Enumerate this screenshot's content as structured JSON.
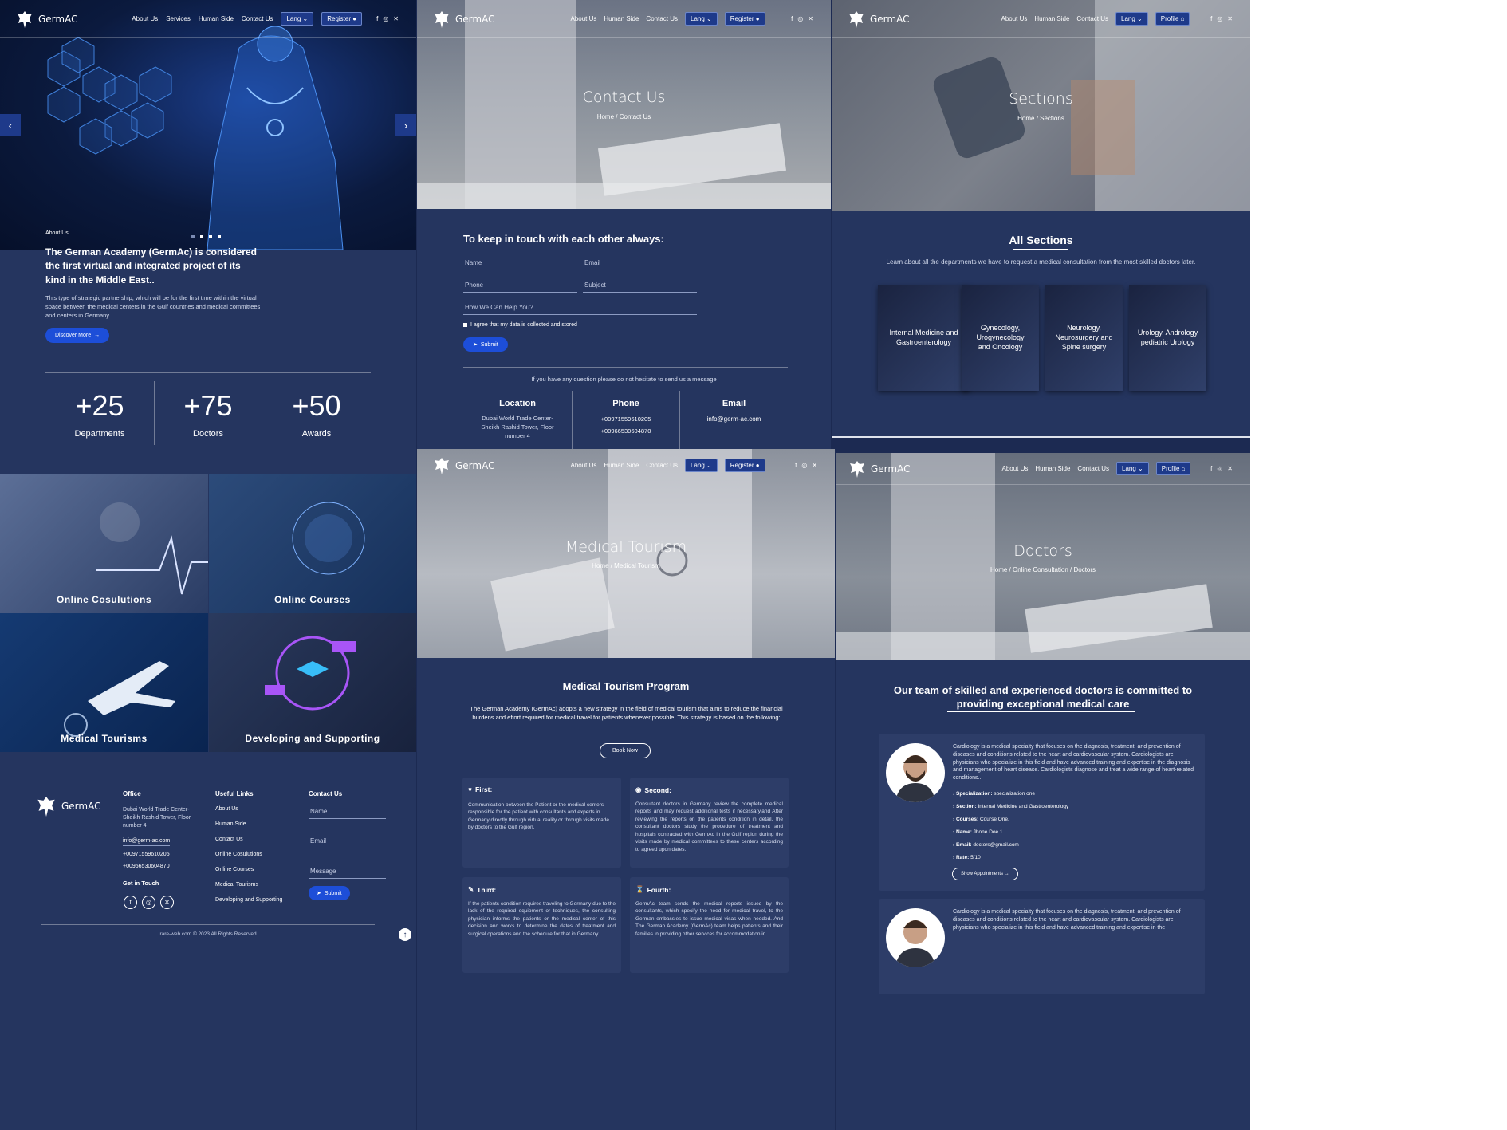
{
  "brand": "GermAC",
  "nav": {
    "about": "About Us",
    "services": "Services",
    "human": "Human Side",
    "contact": "Contact Us",
    "lang": "Lang",
    "register": "Register",
    "profile": "Profile"
  },
  "home": {
    "about_label": "About Us",
    "about_title": "The German Academy (GermAc) is considered the first virtual and integrated project of its kind in the Middle East..",
    "about_text": "This type of strategic partnership, which will be for the first time within the virtual space between the medical centers in the Gulf countries and medical committees and centers in Germany.",
    "discover": "Discover More",
    "stats": [
      {
        "value": "+25",
        "label": "Departments"
      },
      {
        "value": "+75",
        "label": "Doctors"
      },
      {
        "value": "+50",
        "label": "Awards"
      }
    ],
    "tiles": [
      "Online Cosulutions",
      "Online Courses",
      "Medical Tourisms",
      "Developing and Supporting"
    ]
  },
  "footer": {
    "office_h": "Office",
    "office_addr": "Dubai World Trade Center- Sheikh Rashid Tower, Floor number 4",
    "email": "info@germ-ac.com",
    "phone1": "+00971559610205",
    "phone2": "+00966530604870",
    "touch": "Get in Touch",
    "links_h": "Useful Links",
    "links": [
      "About Us",
      "Human Side",
      "Contact Us",
      "Online Cosulutions",
      "Online Courses",
      "Medical Tourisms",
      "Developing and Supporting"
    ],
    "contact_h": "Contact Us",
    "name": "Name",
    "emailf": "Email",
    "message": "Message",
    "submit": "Submit",
    "copyright": "rare-web.com © 2023 All Rights Reserved"
  },
  "contact": {
    "title": "Contact Us",
    "crumb": "Home / Contact Us",
    "heading": "To keep in touch with each other always:",
    "name": "Name",
    "email": "Email",
    "phone": "Phone",
    "subject": "Subject",
    "help": "How We Can Help You?",
    "agree": "I agree that my data is collected and stored",
    "submit": "Submit",
    "note": "If you have any question please do not hesitate to send us a message",
    "loc_h": "Location",
    "loc": "Dubai World Trade Center- Sheikh Rashid Tower, Floor number 4",
    "phone_h": "Phone",
    "ph1": "+00971559610205",
    "ph2": "+00966530604870",
    "email_h": "Email",
    "em": "info@germ-ac.com"
  },
  "sections": {
    "title": "Sections",
    "crumb": "Home / Sections",
    "heading": "All Sections",
    "sub": "Learn about all the departments we have to request a medical consultation from the most skilled doctors later.",
    "cards": [
      "Internal Medicine and Gastroenterology",
      "Gynecology, Urogynecology and Oncology",
      "Neurology, Neurosurgery and Spine surgery",
      "Urology, Andrology pediatric Urology"
    ]
  },
  "tourism": {
    "title": "Medical Tourism",
    "crumb": "Home / Medical Tourism",
    "heading": "Medical Tourism Program",
    "intro": "The German Academy (GermAc) adopts a new strategy in the field of medical tourism that aims to reduce the financial burdens and effort required for medical travel for patients whenever possible. This strategy is based on the following:",
    "book": "Book Now",
    "steps": [
      {
        "h": "First:",
        "t": "Communication between the Patient or the medical centers responsible for the patient with consultants and experts in Germany directly through virtual reality or through visits made by doctors to the Gulf region."
      },
      {
        "h": "Second:",
        "t": "Consultant doctors in Germany review the complete medical reports and may request additional tests if necessary,and After reviewing the reports on the patients condition in detail, the consultant doctors study the procedure of treatment and hospitals contracted with GermAc in the Gulf region during the visits made by medical committees to these centers according to agreed upon dates."
      },
      {
        "h": "Third:",
        "t": "If the patients condition requires traveling to Germany due to the lack of the required equipment or techniques, the consulting physician informs the patients or the medical center of this decision and works to determine the dates of treatment and surgical operations and the schedule for that in Germany."
      },
      {
        "h": "Fourth:",
        "t": "GermAc team sends the medical reports issued by the consultants, which specify the need for medical travel, to the German embassies to issue medical visas when needed. And The German Academy (GermAc) team helps patients and their families in providing other services for accommodation in"
      }
    ]
  },
  "doctors": {
    "title": "Doctors",
    "crumb": "Home / Online Consultation / Doctors",
    "heading": "Our team of skilled and experienced doctors is committed to providing exceptional medical care",
    "desc": "Cardiology is a medical specialty that focuses on the diagnosis, treatment, and prevention of diseases and conditions related to the heart and cardiovascular system. Cardiologists are physicians who specialize in this field and have advanced training and expertise in the diagnosis and management of heart disease. Cardiologists diagnose and treat a wide range of heart-related conditions..",
    "desc2": "Cardiology is a medical specialty that focuses on the diagnosis, treatment, and prevention of diseases and conditions related to the heart and cardiovascular system. Cardiologists are physicians who specialize in this field and have advanced training and expertise in the",
    "spec_l": "Specialization:",
    "spec": "specialization one",
    "sec_l": "Section:",
    "sec": "Internal Medicine and Gastroenterology",
    "course_l": "Courses:",
    "course": "Course One,",
    "name_l": "Name:",
    "name": "Jhone Doe 1",
    "email_l": "Email:",
    "email": "doctors@gmail.com",
    "rate_l": "Rate:",
    "rate": "5/10",
    "appoint": "Show Appointments"
  }
}
